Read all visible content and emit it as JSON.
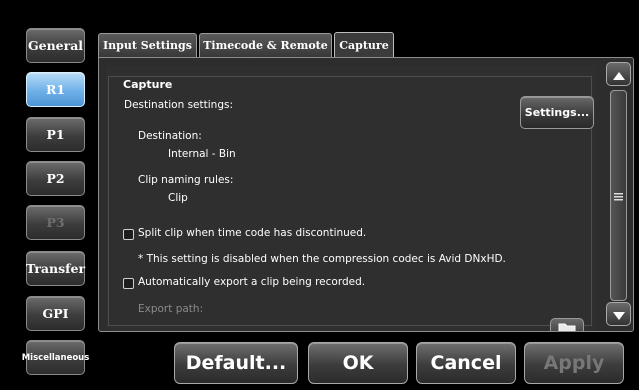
{
  "sidebar": {
    "items": [
      {
        "label": "General"
      },
      {
        "label": "R1"
      },
      {
        "label": "P1"
      },
      {
        "label": "P2"
      },
      {
        "label": "P3"
      },
      {
        "label": "Transfer"
      },
      {
        "label": "GPI"
      },
      {
        "label": "Miscellaneous"
      }
    ],
    "active": "R1",
    "disabled": [
      "P3"
    ]
  },
  "tabs": [
    {
      "label": "Input Settings"
    },
    {
      "label": "Timecode & Remote"
    },
    {
      "label": "Capture"
    }
  ],
  "active_tab": "Capture",
  "capture": {
    "group_title": "Capture",
    "destination_settings_label": "Destination settings:",
    "settings_button": "Settings...",
    "destination_label": "Destination:",
    "destination_value": "Internal - Bin",
    "clip_naming_label": "Clip naming rules:",
    "clip_naming_value": "Clip",
    "split_clip_label": "Split clip when time code has discontinued.",
    "split_clip_checked": false,
    "split_clip_note": "* This setting is disabled when the compression codec is Avid DNxHD.",
    "auto_export_label": "Automatically export a clip being recorded.",
    "auto_export_checked": false,
    "export_path_label": "Export path:"
  },
  "icons": {
    "scroll_up": "triangle-up-icon",
    "scroll_down": "triangle-down-icon",
    "scroll_grip": "grip-lines-icon",
    "folder": "folder-icon"
  },
  "footer": {
    "default_label": "Default...",
    "ok_label": "OK",
    "cancel_label": "Cancel",
    "apply_label": "Apply"
  },
  "colors": {
    "active_accent": "#6eb0e8",
    "background": "#000000",
    "panel": "#2d2d2d"
  }
}
